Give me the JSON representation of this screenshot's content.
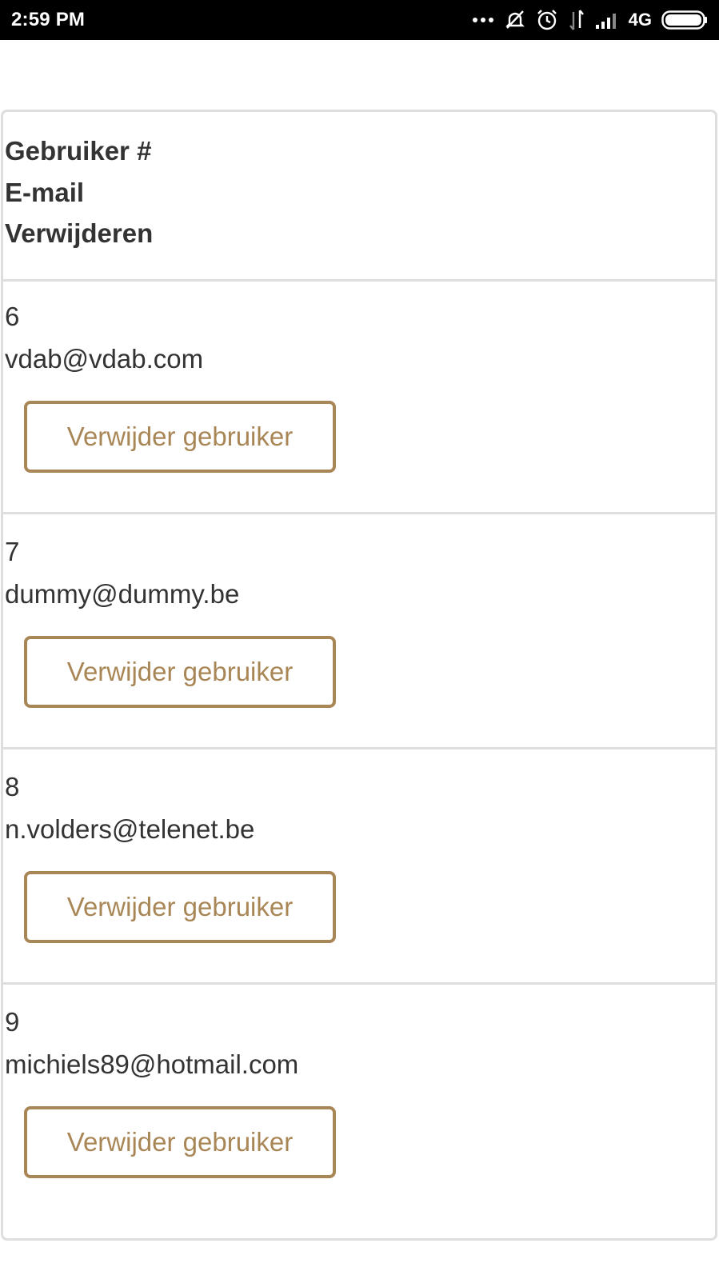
{
  "status_bar": {
    "time": "2:59 PM",
    "network": "4G",
    "icons": [
      "more-dots-icon",
      "mute-icon",
      "alarm-icon",
      "data-transfer-icon",
      "signal-icon",
      "battery-icon"
    ]
  },
  "table": {
    "headers": [
      "Gebruiker #",
      "E-mail",
      "Verwijderen"
    ],
    "rows": [
      {
        "id": "6",
        "email": "vdab@vdab.com",
        "action": "Verwijder gebruiker"
      },
      {
        "id": "7",
        "email": "dummy@dummy.be",
        "action": "Verwijder gebruiker"
      },
      {
        "id": "8",
        "email": "n.volders@telenet.be",
        "action": "Verwijder gebruiker"
      },
      {
        "id": "9",
        "email": "michiels89@hotmail.com",
        "action": "Verwijder gebruiker"
      }
    ]
  },
  "colors": {
    "accent": "#a98656",
    "text": "#333333",
    "border": "#dedede",
    "status_bar": "#000000"
  }
}
